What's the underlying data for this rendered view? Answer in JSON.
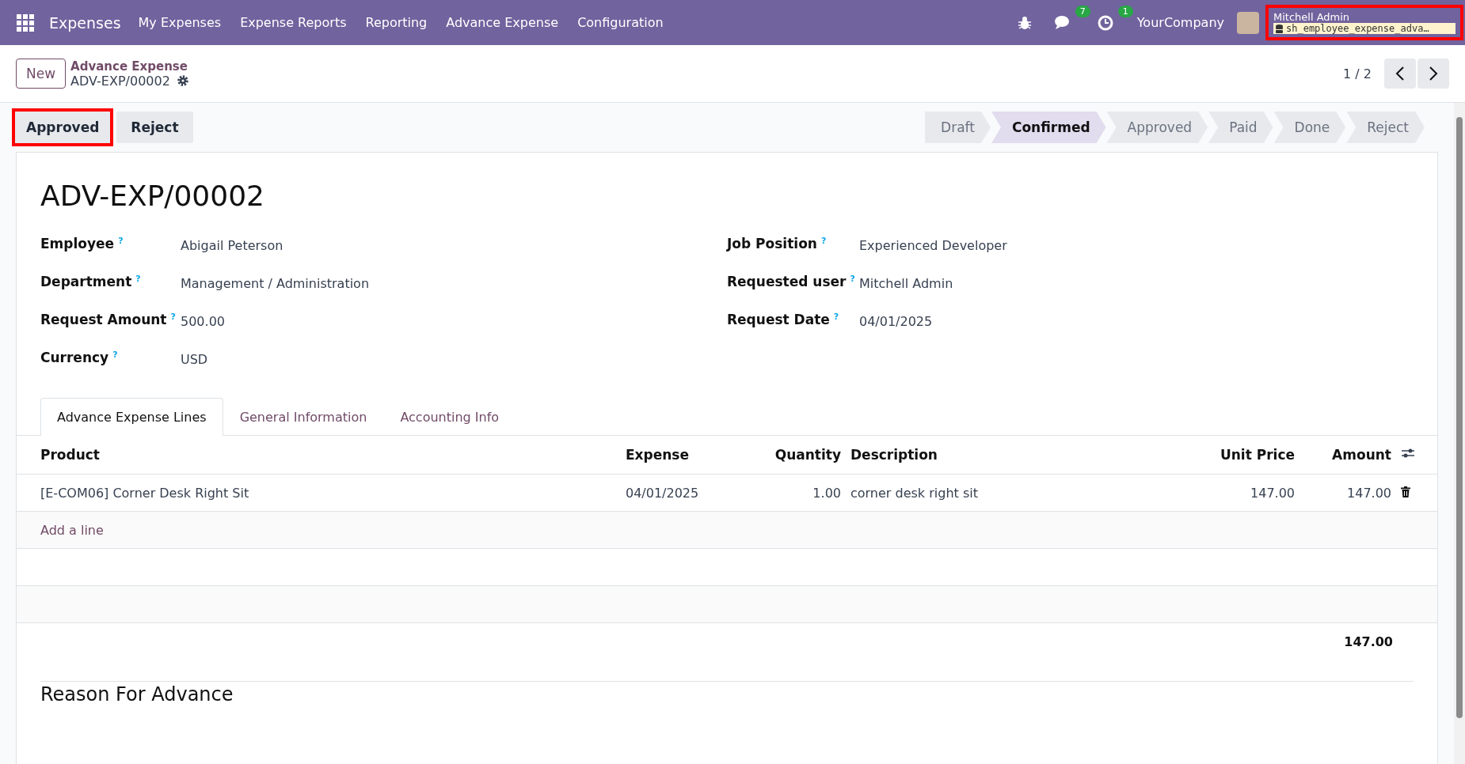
{
  "navbar": {
    "app_name": "Expenses",
    "menu": [
      "My Expenses",
      "Expense Reports",
      "Reporting",
      "Advance Expense",
      "Configuration"
    ],
    "messages_badge": "7",
    "activities_badge": "1",
    "company": "YourCompany",
    "user": {
      "name": "Mitchell Admin",
      "database": "sh_employee_expense_adva…",
      "highlighted": true
    }
  },
  "control_panel": {
    "new_button": "New",
    "breadcrumb": "Advance Expense",
    "record": "ADV-EXP/00002",
    "pager": "1 / 2"
  },
  "actions": [
    {
      "label": "Approved",
      "highlighted": true
    },
    {
      "label": "Reject",
      "highlighted": false
    }
  ],
  "status_steps": [
    {
      "label": "Draft",
      "selected": false
    },
    {
      "label": "Confirmed",
      "selected": true
    },
    {
      "label": "Approved",
      "selected": false
    },
    {
      "label": "Paid",
      "selected": false
    },
    {
      "label": "Done",
      "selected": false
    },
    {
      "label": "Reject",
      "selected": false
    }
  ],
  "form": {
    "title": "ADV-EXP/00002",
    "left_fields": [
      {
        "label": "Employee",
        "help": "?",
        "value": "Abigail Peterson"
      },
      {
        "label": "Department",
        "help": "?",
        "value": "Management / Administration"
      },
      {
        "label": "Request Amount",
        "help": "?",
        "value": "500.00"
      },
      {
        "label": "Currency",
        "help": "?",
        "value": "USD"
      }
    ],
    "right_fields": [
      {
        "label": "Job Position",
        "help": "?",
        "value": "Experienced Developer"
      },
      {
        "label": "Requested user",
        "help": "?",
        "value": "Mitchell Admin"
      },
      {
        "label": "Request Date",
        "help": "?",
        "value": "04/01/2025"
      }
    ],
    "tabs": [
      {
        "label": "Advance Expense Lines",
        "selected": true
      },
      {
        "label": "General Information",
        "selected": false
      },
      {
        "label": "Accounting Info",
        "selected": false
      }
    ],
    "table": {
      "columns": [
        "Product",
        "Expense",
        "Quantity",
        "Description",
        "Unit Price",
        "Amount"
      ],
      "rows": [
        [
          "[E-COM06] Corner Desk Right Sit",
          "04/01/2025",
          "1.00",
          "corner desk right sit",
          "147.00",
          "147.00"
        ]
      ],
      "add_line": "Add a line",
      "total": "147.00"
    },
    "section_title": "Reason For Advance"
  }
}
